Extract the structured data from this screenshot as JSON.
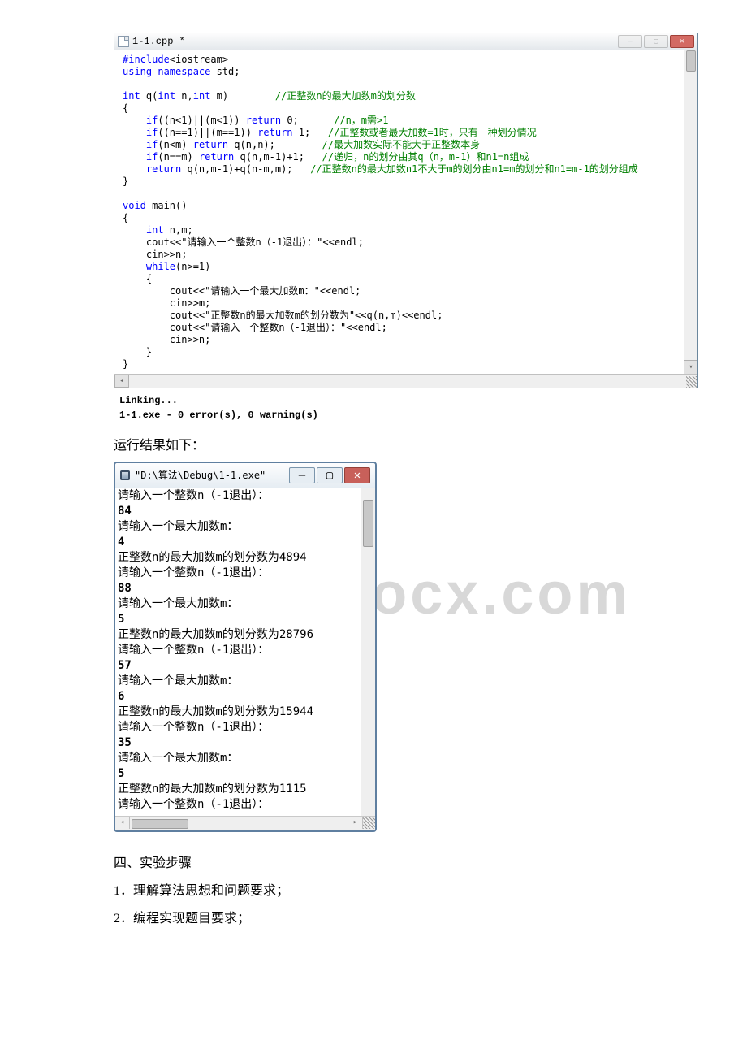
{
  "ide": {
    "tabTitle": "1-1.cpp *",
    "code_lines": [
      {
        "i": 0,
        "t": "    "
      },
      {
        "i": 0,
        "t": "    #include<iostream>",
        "cls": "kw-line"
      },
      {
        "i": 0,
        "t": "    using namespace std;",
        "cls": "kw-line2"
      },
      {
        "i": 0,
        "t": ""
      }
    ]
  },
  "build": {
    "line1": "Linking...",
    "line2": "1-1.exe - 0 error(s), 0 warning(s)"
  },
  "caption1": "运行结果如下：",
  "console": {
    "title": "\"D:\\算法\\Debug\\1-1.exe\"",
    "lines": [
      "请输入一个整数n（-1退出）：",
      "84",
      "请输入一个最大加数m：",
      "4",
      "正整数n的最大加数m的划分数为4894",
      "请输入一个整数n（-1退出）：",
      "88",
      "请输入一个最大加数m：",
      "5",
      "正整数n的最大加数m的划分数为28796",
      "请输入一个整数n（-1退出）：",
      "57",
      "请输入一个最大加数m：",
      "6",
      "正整数n的最大加数m的划分数为15944",
      "请输入一个整数n（-1退出）：",
      "35",
      "请输入一个最大加数m：",
      "5",
      "正整数n的最大加数m的划分数为1115",
      "请输入一个整数n（-1退出）："
    ]
  },
  "doc": {
    "h4": "四、实验步骤",
    "step1": "1．理解算法思想和问题要求；",
    "step2": "2．编程实现题目要求；"
  },
  "watermark": "www.bdocx.com",
  "code": {
    "l1a": "#include",
    "l1b": "<iostream>",
    "l2a": "using namespace",
    "l2b": " std;",
    "l3a": "int",
    "l3b": " q(",
    "l3c": "int",
    "l3d": " n,",
    "l3e": "int",
    "l3f": " m)        ",
    "l3g": "//正整数n的最大加数m的划分数",
    "l4": "{",
    "l5a": "    if",
    "l5b": "((n<1)||(m<1)) ",
    "l5c": "return",
    "l5d": " 0;      ",
    "l5e": "//n，m需>1",
    "l6a": "    if",
    "l6b": "((n==1)||(m==1)) ",
    "l6c": "return",
    "l6d": " 1;   ",
    "l6e": "//正整数或者最大加数=1时，只有一种划分情况",
    "l7a": "    if",
    "l7b": "(n<m) ",
    "l7c": "return",
    "l7d": " q(n,n);        ",
    "l7e": "//最大加数实际不能大于正整数本身",
    "l8a": "    if",
    "l8b": "(n==m) ",
    "l8c": "return",
    "l8d": " q(n,m-1)+1;   ",
    "l8e": "//递归，n的划分由其q（n，m-1）和n1=n组成",
    "l9a": "    return",
    "l9b": " q(n,m-1)+q(n-m,m);   ",
    "l9c": "//正整数n的最大加数n1不大于m的划分由n1=m的划分和n1=m-1的划分组成",
    "l10": "}",
    "l11a": "void",
    "l11b": " main()",
    "l12": "{",
    "l13a": "    int",
    "l13b": " n,m;",
    "l14": "    cout<<\"请输入一个整数n（-1退出）：\"<<endl;",
    "l15": "    cin>>n;",
    "l16a": "    while",
    "l16b": "(n>=1)",
    "l17": "    {",
    "l18": "        cout<<\"请输入一个最大加数m：\"<<endl;",
    "l19": "        cin>>m;",
    "l20": "        cout<<\"正整数n的最大加数m的划分数为\"<<q(n,m)<<endl;",
    "l21": "        cout<<\"请输入一个整数n（-1退出）：\"<<endl;",
    "l22": "        cin>>n;",
    "l23": "    }",
    "l24": "}"
  }
}
